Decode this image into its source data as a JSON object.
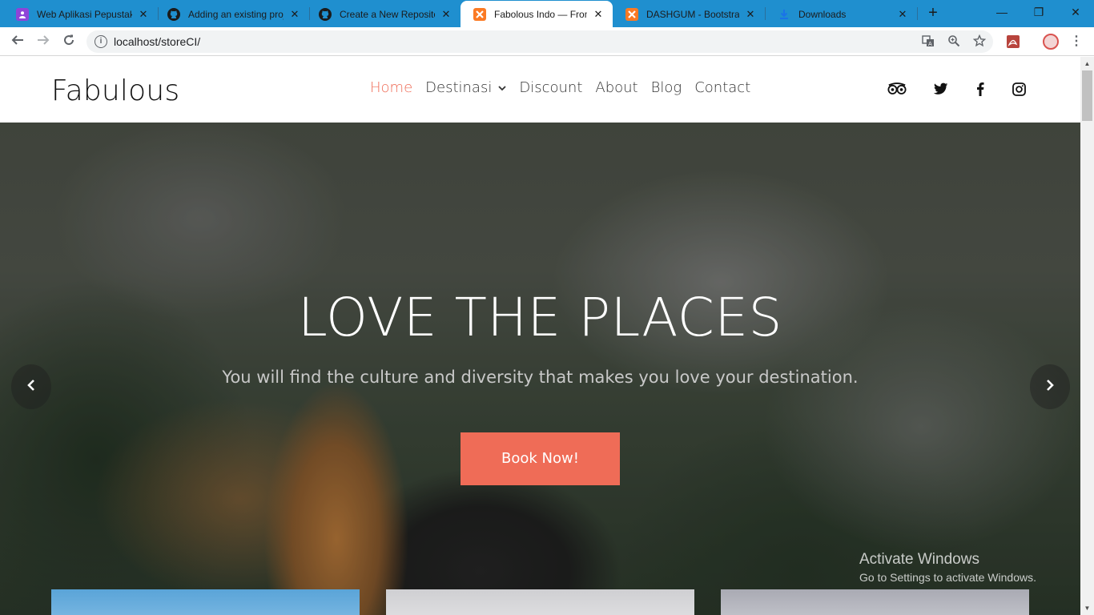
{
  "browser": {
    "tabs": [
      {
        "title": "Web Aplikasi Pepustakaa",
        "icon": "purple-app-icon",
        "color": "#8e44d8"
      },
      {
        "title": "Adding an existing proj",
        "icon": "github-icon",
        "color": "#1b1b1b"
      },
      {
        "title": "Create a New Repositor",
        "icon": "github-icon",
        "color": "#1b1b1b"
      },
      {
        "title": "Fabolous Indo — From",
        "icon": "xampp-icon",
        "color": "#fb7a24",
        "active": true
      },
      {
        "title": "DASHGUM - Bootstrap",
        "icon": "xampp-icon",
        "color": "#fb7a24"
      },
      {
        "title": "Downloads",
        "icon": "download-icon",
        "color": "#1a73e8"
      }
    ],
    "new_tab": "+",
    "window_controls": {
      "minimize": "—",
      "restore": "❐",
      "close": "✕"
    },
    "url": "localhost/storeCI/"
  },
  "site": {
    "brand": "Fabulous",
    "nav": [
      {
        "label": "Home",
        "active": true
      },
      {
        "label": "Destinasi",
        "dropdown": true
      },
      {
        "label": "Discount"
      },
      {
        "label": "About"
      },
      {
        "label": "Blog"
      },
      {
        "label": "Contact"
      }
    ],
    "social": [
      "tripadvisor-icon",
      "twitter-icon",
      "facebook-icon",
      "instagram-icon"
    ],
    "accent": "#ef6c57"
  },
  "hero": {
    "title": "LOVE THE PLACES",
    "subtitle": "You will find the culture and diversity that makes you love your destination.",
    "cta": "Book Now!",
    "prev": "‹",
    "next": "›"
  },
  "os_watermark": {
    "line1": "Activate Windows",
    "line2": "Go to Settings to activate Windows."
  }
}
